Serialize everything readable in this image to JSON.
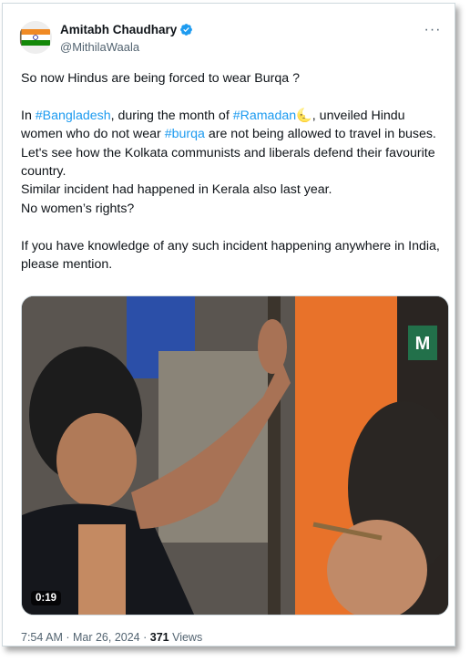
{
  "author": {
    "display_name": "Amitabh Chaudhary",
    "handle": "@MithilaWaala",
    "verified": true
  },
  "tweet": {
    "line1": "So now Hindus are being forced to wear Burqa ?",
    "para2_part1": "In ",
    "hashtag_bangladesh": "#Bangladesh",
    "para2_part2": ", during the month of ",
    "hashtag_ramadan": "#Ramadan",
    "crescent_emoji": "🌜",
    "para2_part3": ", unveiled Hindu women who do not wear  ",
    "hashtag_burqa": "#burqa",
    "para2_part4": " are not being allowed to travel in buses.",
    "line3": "Let's see how the Kolkata communists and liberals defend their favourite country.",
    "line4": "Similar incident had happened in Kerala also last year.",
    "line5": "No women’s rights?",
    "line6": "If you have knowledge of any such incident happening anywhere in India, please mention."
  },
  "media": {
    "duration": "0:19",
    "watermark_letter": "M"
  },
  "meta": {
    "time_date": "7:54 AM · Mar 26, 2024 · ",
    "views_count": "371",
    "views_label": " Views"
  },
  "colors": {
    "link": "#1d9bf0",
    "verified": "#1d9bf0",
    "muted": "#536471",
    "border": "#cfd9de"
  },
  "icons": [
    "flag-avatar-icon",
    "verified-badge-icon",
    "more-options-icon"
  ]
}
